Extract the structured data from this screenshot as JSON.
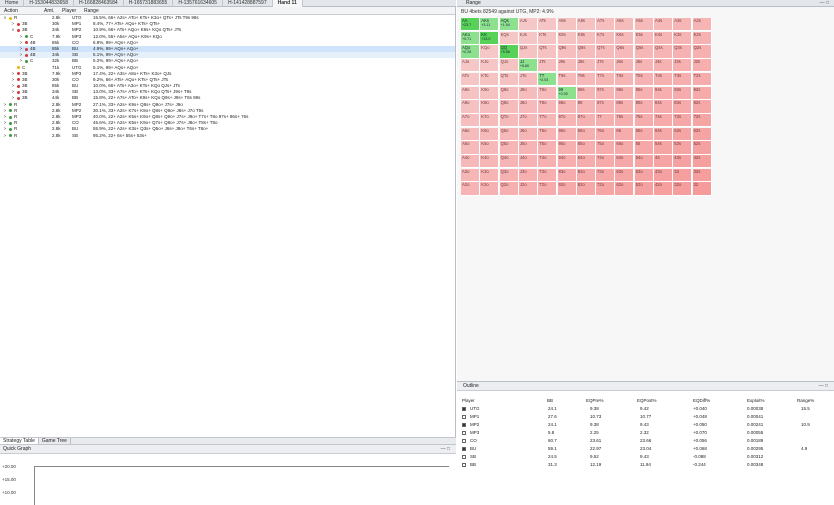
{
  "tabs": [
    "Home",
    "H-153044833658",
    "H-166828463584",
    "H-165731883655",
    "H-135761634605",
    "H-141428887597",
    "Hand 11"
  ],
  "active_tab": 6,
  "tree": {
    "columns": [
      "Action",
      "Amt.",
      "Player",
      "Range"
    ],
    "rows": [
      {
        "indent": 0,
        "exp": "v",
        "color": "#e6b800",
        "act": "R",
        "amt": "2.8k",
        "player": "UTO",
        "range": "15.5%, 66+ A2s+ ATo+ KTs+ K3o+ QTs+ JTs T9s 98s",
        "sel": false
      },
      {
        "indent": 1,
        "exp": ">",
        "color": "#d43a3a",
        "act": "3B",
        "amt": "30k",
        "player": "MP1",
        "range": "8.4%, 77+ ATs+ AQo+ KTs+ QTs+",
        "sel": false
      },
      {
        "indent": 1,
        "exp": "v",
        "color": "#d43a3a",
        "act": "3B",
        "amt": "34k",
        "player": "MP2",
        "range": "10.9%, 66+ ATs+ AQo+ K9s+ KQo QTs+ JTs",
        "sel": false
      },
      {
        "indent": 2,
        "exp": ">",
        "color": "#3a9a3a",
        "act": "C",
        "amt": "7.9k",
        "player": "MP3",
        "range": "12.0%, 55+ A5s+ AQo+ K9s+ KQo",
        "sel": false
      },
      {
        "indent": 2,
        "exp": ">",
        "color": "#d43a3a",
        "act": "4B",
        "amt": "85k",
        "player": "CO",
        "range": "6.9%, 99+ AQs+ AQo+",
        "sel": false
      },
      {
        "indent": 2,
        "exp": ">",
        "color": "#d43a3a",
        "act": "4B",
        "amt": "85k",
        "player": "BU",
        "range": "4.9%, 99+ AQs+ AQo+",
        "sel": true
      },
      {
        "indent": 2,
        "exp": ">",
        "color": "#d43a3a",
        "act": "4B",
        "amt": "34k",
        "player": "SB",
        "range": "5.1%, 99+ AQs+ AQo+",
        "sel": false
      },
      {
        "indent": 2,
        "exp": ">",
        "color": "#3a9a3a",
        "act": "C",
        "amt": "32k",
        "player": "BB",
        "range": "5.2%, 99+ AQs+ AQo+",
        "sel": false
      },
      {
        "indent": 1,
        "exp": "",
        "color": "#e6b800",
        "act": "C",
        "amt": "71k",
        "player": "UTG",
        "range": "5.1%, 99+ AQs+ AQo+",
        "sel": false
      },
      {
        "indent": 1,
        "exp": ">",
        "color": "#d43a3a",
        "act": "3B",
        "amt": "7.9k",
        "player": "MP3",
        "range": "17.4%, 22+ A3s+ A8o+ KTs+ K3o+ QJs",
        "sel": false
      },
      {
        "indent": 1,
        "exp": ">",
        "color": "#d43a3a",
        "act": "3B",
        "amt": "30k",
        "player": "CO",
        "range": "9.2%, 66+ ATs+ AQo+ KTs+ QTs+ JTs",
        "sel": false
      },
      {
        "indent": 1,
        "exp": ">",
        "color": "#d43a3a",
        "act": "3B",
        "amt": "85k",
        "player": "BU",
        "range": "10.0%, 66+ ATs+ A3o+ KTs+ KQo QJs+ JTs",
        "sel": false
      },
      {
        "indent": 1,
        "exp": ">",
        "color": "#d43a3a",
        "act": "3B",
        "amt": "34k",
        "player": "SB",
        "range": "13.0%, 33+ A7s+ ATo+ KTs+ KQo QTs+ J9s+ T9s",
        "sel": false
      },
      {
        "indent": 1,
        "exp": ">",
        "color": "#d43a3a",
        "act": "3B",
        "amt": "44k",
        "player": "BB",
        "range": "15.8%, 22+ A7s+ ATo+ K9s+ KQo Q9s+ J9s+ T8s 98s",
        "sel": false
      },
      {
        "indent": 0,
        "exp": ">",
        "color": "#3a9a3a",
        "act": "R",
        "amt": "2.8k",
        "player": "MP2",
        "range": "27.1%, 33+ A2s+ K9s+ Q8s+ Q9o+ J7s+ J9o",
        "sel": false
      },
      {
        "indent": 0,
        "exp": ">",
        "color": "#3a9a3a",
        "act": "R",
        "amt": "2.8k",
        "player": "MP2",
        "range": "30.1%, 33+ A2s+ K7s+ K9o+ Q8s+ Q9o+ J8s+ J7o T9s",
        "sel": false
      },
      {
        "indent": 0,
        "exp": ">",
        "color": "#3a9a3a",
        "act": "R",
        "amt": "2.8k",
        "player": "MP3",
        "range": "40.0%, 22+ A2s+ K5s+ K9o+ Q8s+ Q9o+ J7s+ J9o+ T7s+ T8o 97s+ 86s+ 76s",
        "sel": false
      },
      {
        "indent": 0,
        "exp": ">",
        "color": "#3a9a3a",
        "act": "R",
        "amt": "2.8k",
        "player": "CO",
        "range": "45.6%, 22+ A2s+ K5s+ K9o+ Q7s+ Q8o+ J7s+ J8o+ T8s+ T8o",
        "sel": false
      },
      {
        "indent": 0,
        "exp": ">",
        "color": "#3a9a3a",
        "act": "R",
        "amt": "2.8k",
        "player": "BU",
        "range": "55.9%, 22+ A2s+ K3s+ Q3s+ Q5o+ J6s+ J8o+ T6s+ T8o+",
        "sel": false
      },
      {
        "indent": 0,
        "exp": ">",
        "color": "#3a9a3a",
        "act": "R",
        "amt": "2.8k",
        "player": "SB",
        "range": "95.2%, 22+ 6s+ 55s+ 53s+",
        "sel": false
      }
    ]
  },
  "bottom_tabs": [
    "Strategy Table",
    "Game Tree"
  ],
  "quick_graph": {
    "title": "Quick Graph",
    "ticks": [
      "+20.00",
      "+15.00",
      "+10.00"
    ]
  },
  "range_panel": {
    "tab": "Range",
    "subtitle": "BU 4bets 82549 against UTG, MP2: 4.9%",
    "ranks": [
      "A",
      "K",
      "Q",
      "J",
      "T",
      "9",
      "8",
      "7",
      "6",
      "5",
      "4",
      "3",
      "2"
    ],
    "green_cells": [
      {
        "r": 0,
        "c": 0,
        "val": "+23.7",
        "dk": true
      },
      {
        "r": 0,
        "c": 1,
        "val": "+3.11",
        "dk": true
      },
      {
        "r": 0,
        "c": 2,
        "val": "+1.94",
        "dk": true
      },
      {
        "r": 1,
        "c": 0,
        "val": "+0.71",
        "dk": true
      },
      {
        "r": 1,
        "c": 1,
        "val": "+13.0",
        "dk": true
      },
      {
        "r": 2,
        "c": 0,
        "val": "+0.28",
        "dk": true
      },
      {
        "r": 2,
        "c": 2,
        "val": "+9.58",
        "dk": true
      },
      {
        "r": 3,
        "c": 3,
        "val": "+5.80",
        "dk": true
      },
      {
        "r": 4,
        "c": 4,
        "val": "+2.03",
        "dk": true
      },
      {
        "r": 5,
        "c": 5,
        "val": "+0.39",
        "dk": true
      }
    ]
  },
  "outline": {
    "title": "Outline",
    "columns": [
      "Player",
      "BB",
      "EQPre%",
      "EQPost%",
      "EQDiff%",
      "Exploit%",
      "Range%"
    ],
    "rows": [
      {
        "checked": true,
        "player": "UTG",
        "bb": "24.1",
        "pre": "9.38",
        "post": "9.42",
        "diff": "+0.040",
        "exploit": "0.00038",
        "range": "15.5"
      },
      {
        "checked": false,
        "player": "MP1",
        "bb": "27.6",
        "pre": "10.73",
        "post": "10.77",
        "diff": "+0.048",
        "exploit": "0.00041",
        "range": ""
      },
      {
        "checked": true,
        "player": "MP2",
        "bb": "24.1",
        "pre": "9.38",
        "post": "9.43",
        "diff": "+0.050",
        "exploit": "0.00241",
        "range": "10.9"
      },
      {
        "checked": false,
        "player": "MP3",
        "bb": "5.8",
        "pre": "2.25",
        "post": "2.32",
        "diff": "+0.070",
        "exploit": "0.00055",
        "range": ""
      },
      {
        "checked": false,
        "player": "CO",
        "bb": "60.7",
        "pre": "23.61",
        "post": "23.66",
        "diff": "+0.056",
        "exploit": "0.00189",
        "range": ""
      },
      {
        "checked": true,
        "player": "BU",
        "bb": "59.1",
        "pre": "22.97",
        "post": "23.04",
        "diff": "+0.068",
        "exploit": "0.00295",
        "range": "4.9"
      },
      {
        "checked": false,
        "player": "SB",
        "bb": "24.5",
        "pre": "9.52",
        "post": "9.43",
        "diff": "-0.088",
        "exploit": "0.00312",
        "range": ""
      },
      {
        "checked": false,
        "player": "BB",
        "bb": "31.3",
        "pre": "12.19",
        "post": "11.94",
        "diff": "-0.244",
        "exploit": "0.00348",
        "range": ""
      }
    ]
  }
}
